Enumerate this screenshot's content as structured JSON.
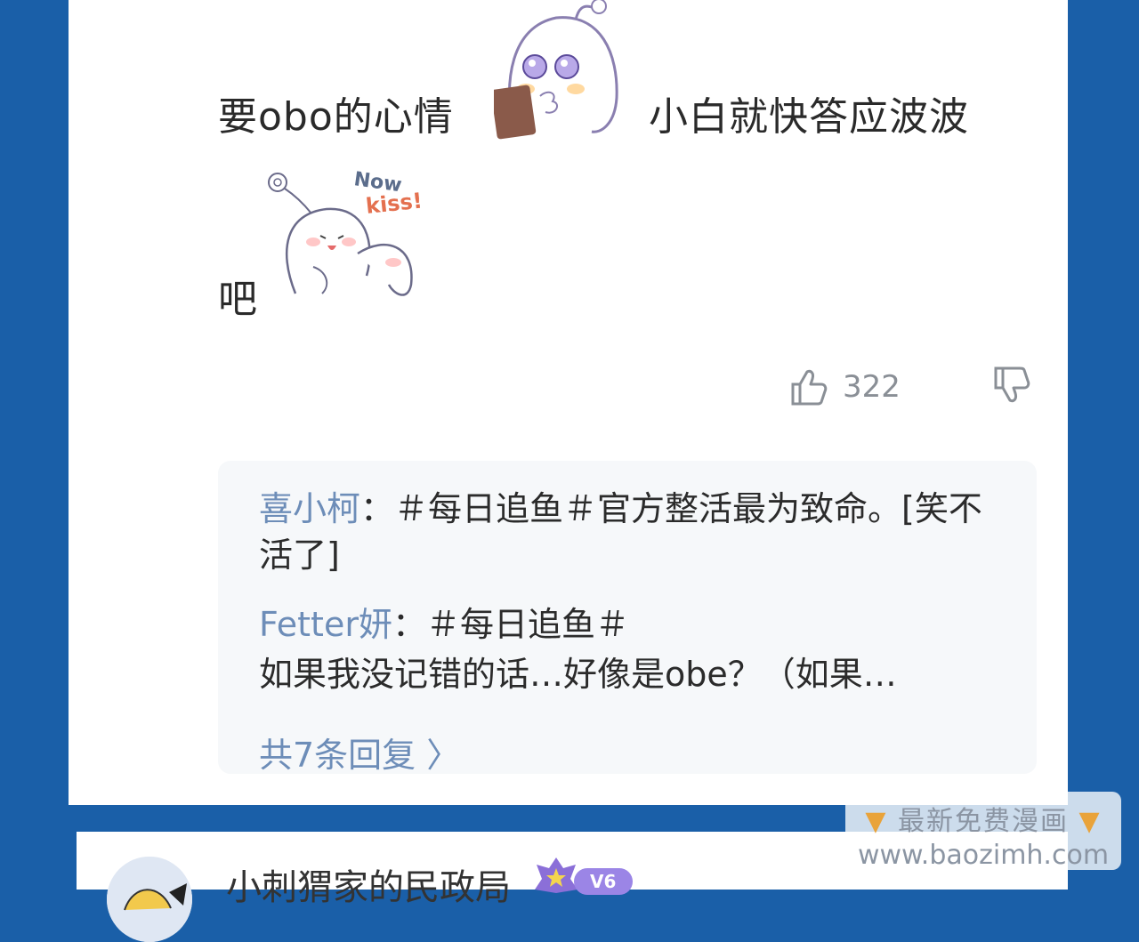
{
  "post": {
    "text_before_sticker": "要obo的心情",
    "text_after_sticker": "小白就快答应波波",
    "line2_text": "吧",
    "sticker_text": "Now kiss!",
    "like_count": "322"
  },
  "replies": [
    {
      "name": "喜小柯",
      "text": "：＃每日追鱼＃官方整活最为致命。[笑不活了]"
    },
    {
      "name": "Fetter妍",
      "text": "：＃每日追鱼＃",
      "text2": "如果我没记错的话…好像是obe？（如果…"
    }
  ],
  "more_replies": "共7条回复 〉",
  "next_post": {
    "username": "小刺猬家的民政局",
    "level_badge": "V6"
  },
  "watermark": {
    "line1": "最新免费漫画",
    "line2": "www.baozimh.com"
  },
  "colors": {
    "background": "#1a5fa8",
    "name_link": "#6d8db8",
    "badge": "#8b6fd8"
  }
}
